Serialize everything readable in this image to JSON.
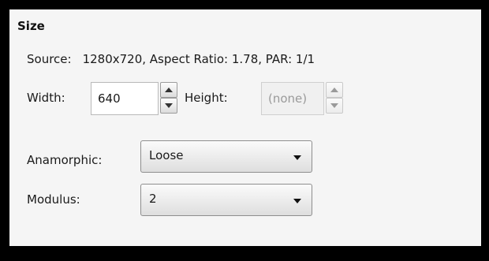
{
  "section": {
    "title": "Size"
  },
  "source": {
    "label": "Source:",
    "value": "1280x720, Aspect Ratio: 1.78, PAR: 1/1"
  },
  "width": {
    "label": "Width:",
    "value": "640"
  },
  "height": {
    "label": "Height:",
    "value": "(none)",
    "disabled": true
  },
  "anamorphic": {
    "label": "Anamorphic:",
    "selected": "Loose"
  },
  "modulus": {
    "label": "Modulus:",
    "selected": "2"
  },
  "icons": {
    "spin_up": "triangle-up-icon",
    "spin_down": "triangle-down-icon",
    "dropdown": "chevron-down-icon"
  },
  "colors": {
    "frame": "#000000",
    "panel_background": "#f5f5f5",
    "disabled_text": "#9a9a9a"
  }
}
